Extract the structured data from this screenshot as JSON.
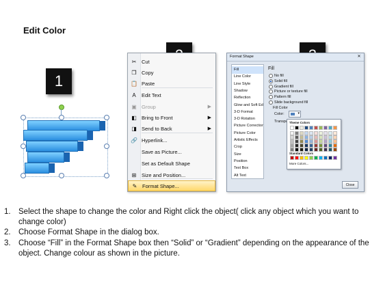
{
  "page": {
    "title": "Edit Color",
    "badges": [
      "1",
      "2",
      "3"
    ]
  },
  "context_menu": {
    "items": [
      {
        "label": "Cut",
        "icon": "scissors-icon",
        "glyph": "✂",
        "disabled": false,
        "submenu": false
      },
      {
        "label": "Copy",
        "icon": "copy-icon",
        "glyph": "❐",
        "disabled": false,
        "submenu": false
      },
      {
        "label": "Paste",
        "icon": "paste-icon",
        "glyph": "📋",
        "disabled": false,
        "submenu": false
      },
      {
        "label": "Edit Text",
        "icon": "edit-text-icon",
        "glyph": "A",
        "disabled": false,
        "submenu": false
      },
      {
        "label": "Group",
        "icon": "group-icon",
        "glyph": "▣",
        "disabled": true,
        "submenu": true
      },
      {
        "label": "Bring to Front",
        "icon": "bring-front-icon",
        "glyph": "◧",
        "disabled": false,
        "submenu": true
      },
      {
        "label": "Send to Back",
        "icon": "send-back-icon",
        "glyph": "◨",
        "disabled": false,
        "submenu": true
      },
      {
        "label": "Hyperlink...",
        "icon": "hyperlink-icon",
        "glyph": "🔗",
        "disabled": false,
        "submenu": false
      },
      {
        "label": "Save as Picture...",
        "icon": "",
        "glyph": "",
        "disabled": false,
        "submenu": false
      },
      {
        "label": "Set as Default Shape",
        "icon": "",
        "glyph": "",
        "disabled": false,
        "submenu": false
      },
      {
        "label": "Size and Position...",
        "icon": "size-position-icon",
        "glyph": "⊞",
        "disabled": false,
        "submenu": false
      },
      {
        "label": "Format Shape...",
        "icon": "format-shape-icon",
        "glyph": "✎",
        "disabled": false,
        "submenu": false,
        "highlighted": true
      }
    ]
  },
  "dialog": {
    "title": "Format Shape",
    "close_glyph": "✕",
    "categories": [
      "Fill",
      "Line Color",
      "Line Style",
      "Shadow",
      "Reflection",
      "Glow and Soft Edges",
      "3-D Format",
      "3-D Rotation",
      "Picture Corrections",
      "Picture Color",
      "Artistic Effects",
      "Crop",
      "Size",
      "Position",
      "Text Box",
      "Alt Text"
    ],
    "selected_category": "Fill",
    "heading": "Fill",
    "options": [
      {
        "label": "No fill",
        "on": false
      },
      {
        "label": "Solid fill",
        "on": true
      },
      {
        "label": "Gradient fill",
        "on": false
      },
      {
        "label": "Picture or texture fill",
        "on": false
      },
      {
        "label": "Pattern fill",
        "on": false
      },
      {
        "label": "Slide background fill",
        "on": false
      }
    ],
    "fill_color_label": "Fill Color",
    "color_label": "Color:",
    "transparency_label": "Transparency:",
    "close_button": "Close"
  },
  "palette": {
    "theme_label": "Theme Colors",
    "standard_label": "Standard Colors",
    "more_label": "More Colors...",
    "theme_top": [
      "#ffffff",
      "#000000",
      "#eeece1",
      "#1f497d",
      "#4f81bd",
      "#c0504d",
      "#9bbb59",
      "#8064a2",
      "#4bacc6",
      "#f79646"
    ],
    "theme_shades": [
      [
        "#f2f2f2",
        "#7f7f7f",
        "#ddd9c3",
        "#c6d9f0",
        "#dbe5f1",
        "#f2dcdb",
        "#ebf1dd",
        "#e5e0ec",
        "#dbeef3",
        "#fdeada"
      ],
      [
        "#d8d8d8",
        "#595959",
        "#c4bd97",
        "#8db3e2",
        "#b8cce4",
        "#e5b9b7",
        "#d7e3bc",
        "#ccc1d9",
        "#b7dde8",
        "#fbd5b5"
      ],
      [
        "#bfbfbf",
        "#3f3f3f",
        "#938953",
        "#548dd4",
        "#95b3d7",
        "#d99694",
        "#c3d69b",
        "#b2a2c7",
        "#92cddc",
        "#fac08f"
      ],
      [
        "#a5a5a5",
        "#262626",
        "#494429",
        "#17365d",
        "#366092",
        "#953734",
        "#76923c",
        "#5f497a",
        "#31859b",
        "#e36c09"
      ],
      [
        "#7f7f7f",
        "#0c0c0c",
        "#1d1b10",
        "#0f243e",
        "#244061",
        "#632423",
        "#4f6128",
        "#3f3151",
        "#205867",
        "#974806"
      ]
    ],
    "standard": [
      "#c00000",
      "#ff0000",
      "#ffc000",
      "#ffff00",
      "#92d050",
      "#00b050",
      "#00b0f0",
      "#0070c0",
      "#002060",
      "#7030a0"
    ]
  },
  "instructions": [
    {
      "num": "1.",
      "text": "Select the shape to change the color and Right click the object( click any object which you want to change color)"
    },
    {
      "num": "2.",
      "text": "Choose Format Shape in the dialog box."
    },
    {
      "num": "3.",
      "text": "Choose “Fill” in the Format Shape box then “Solid” or “Gradient” depending on the appearance of the object. Change colour as shown in the picture."
    }
  ]
}
